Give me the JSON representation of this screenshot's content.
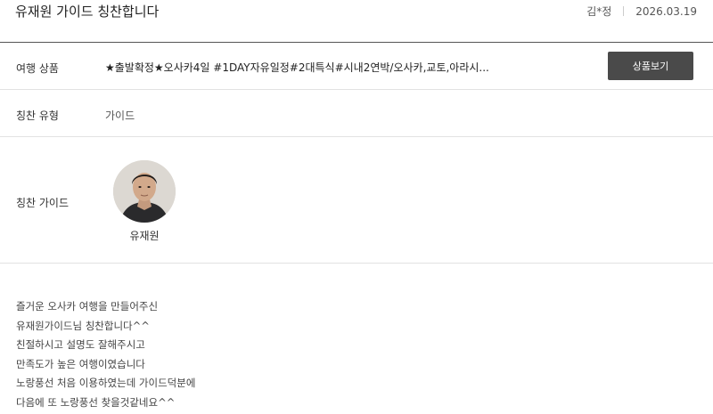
{
  "header": {
    "title": "유재원 가이드 칭찬합니다",
    "author": "김*정",
    "date": "2026.03.19"
  },
  "product": {
    "label": "여행 상품",
    "value": "★출발확정★오사카4일 #1DAY자유일정#2대특식#시내2연박/오사카,교토,아라시...",
    "button_label": "상품보기"
  },
  "praise_type": {
    "label": "칭찬 유형",
    "value": "가이드"
  },
  "praise_guide": {
    "label": "칭찬 가이드",
    "name": "유재원"
  },
  "review": {
    "lines": [
      "즐거운 오사카 여행을 만들어주신",
      "유재원가이드님 칭찬합니다^^",
      "친절하시고 설명도 잘해주시고",
      "만족도가 높은 여행이였습니다",
      "노랑풍선 처음 이용하였는데 가이드덕분에",
      "다음에 또 노랑풍선 찾을것같네요^^"
    ]
  }
}
